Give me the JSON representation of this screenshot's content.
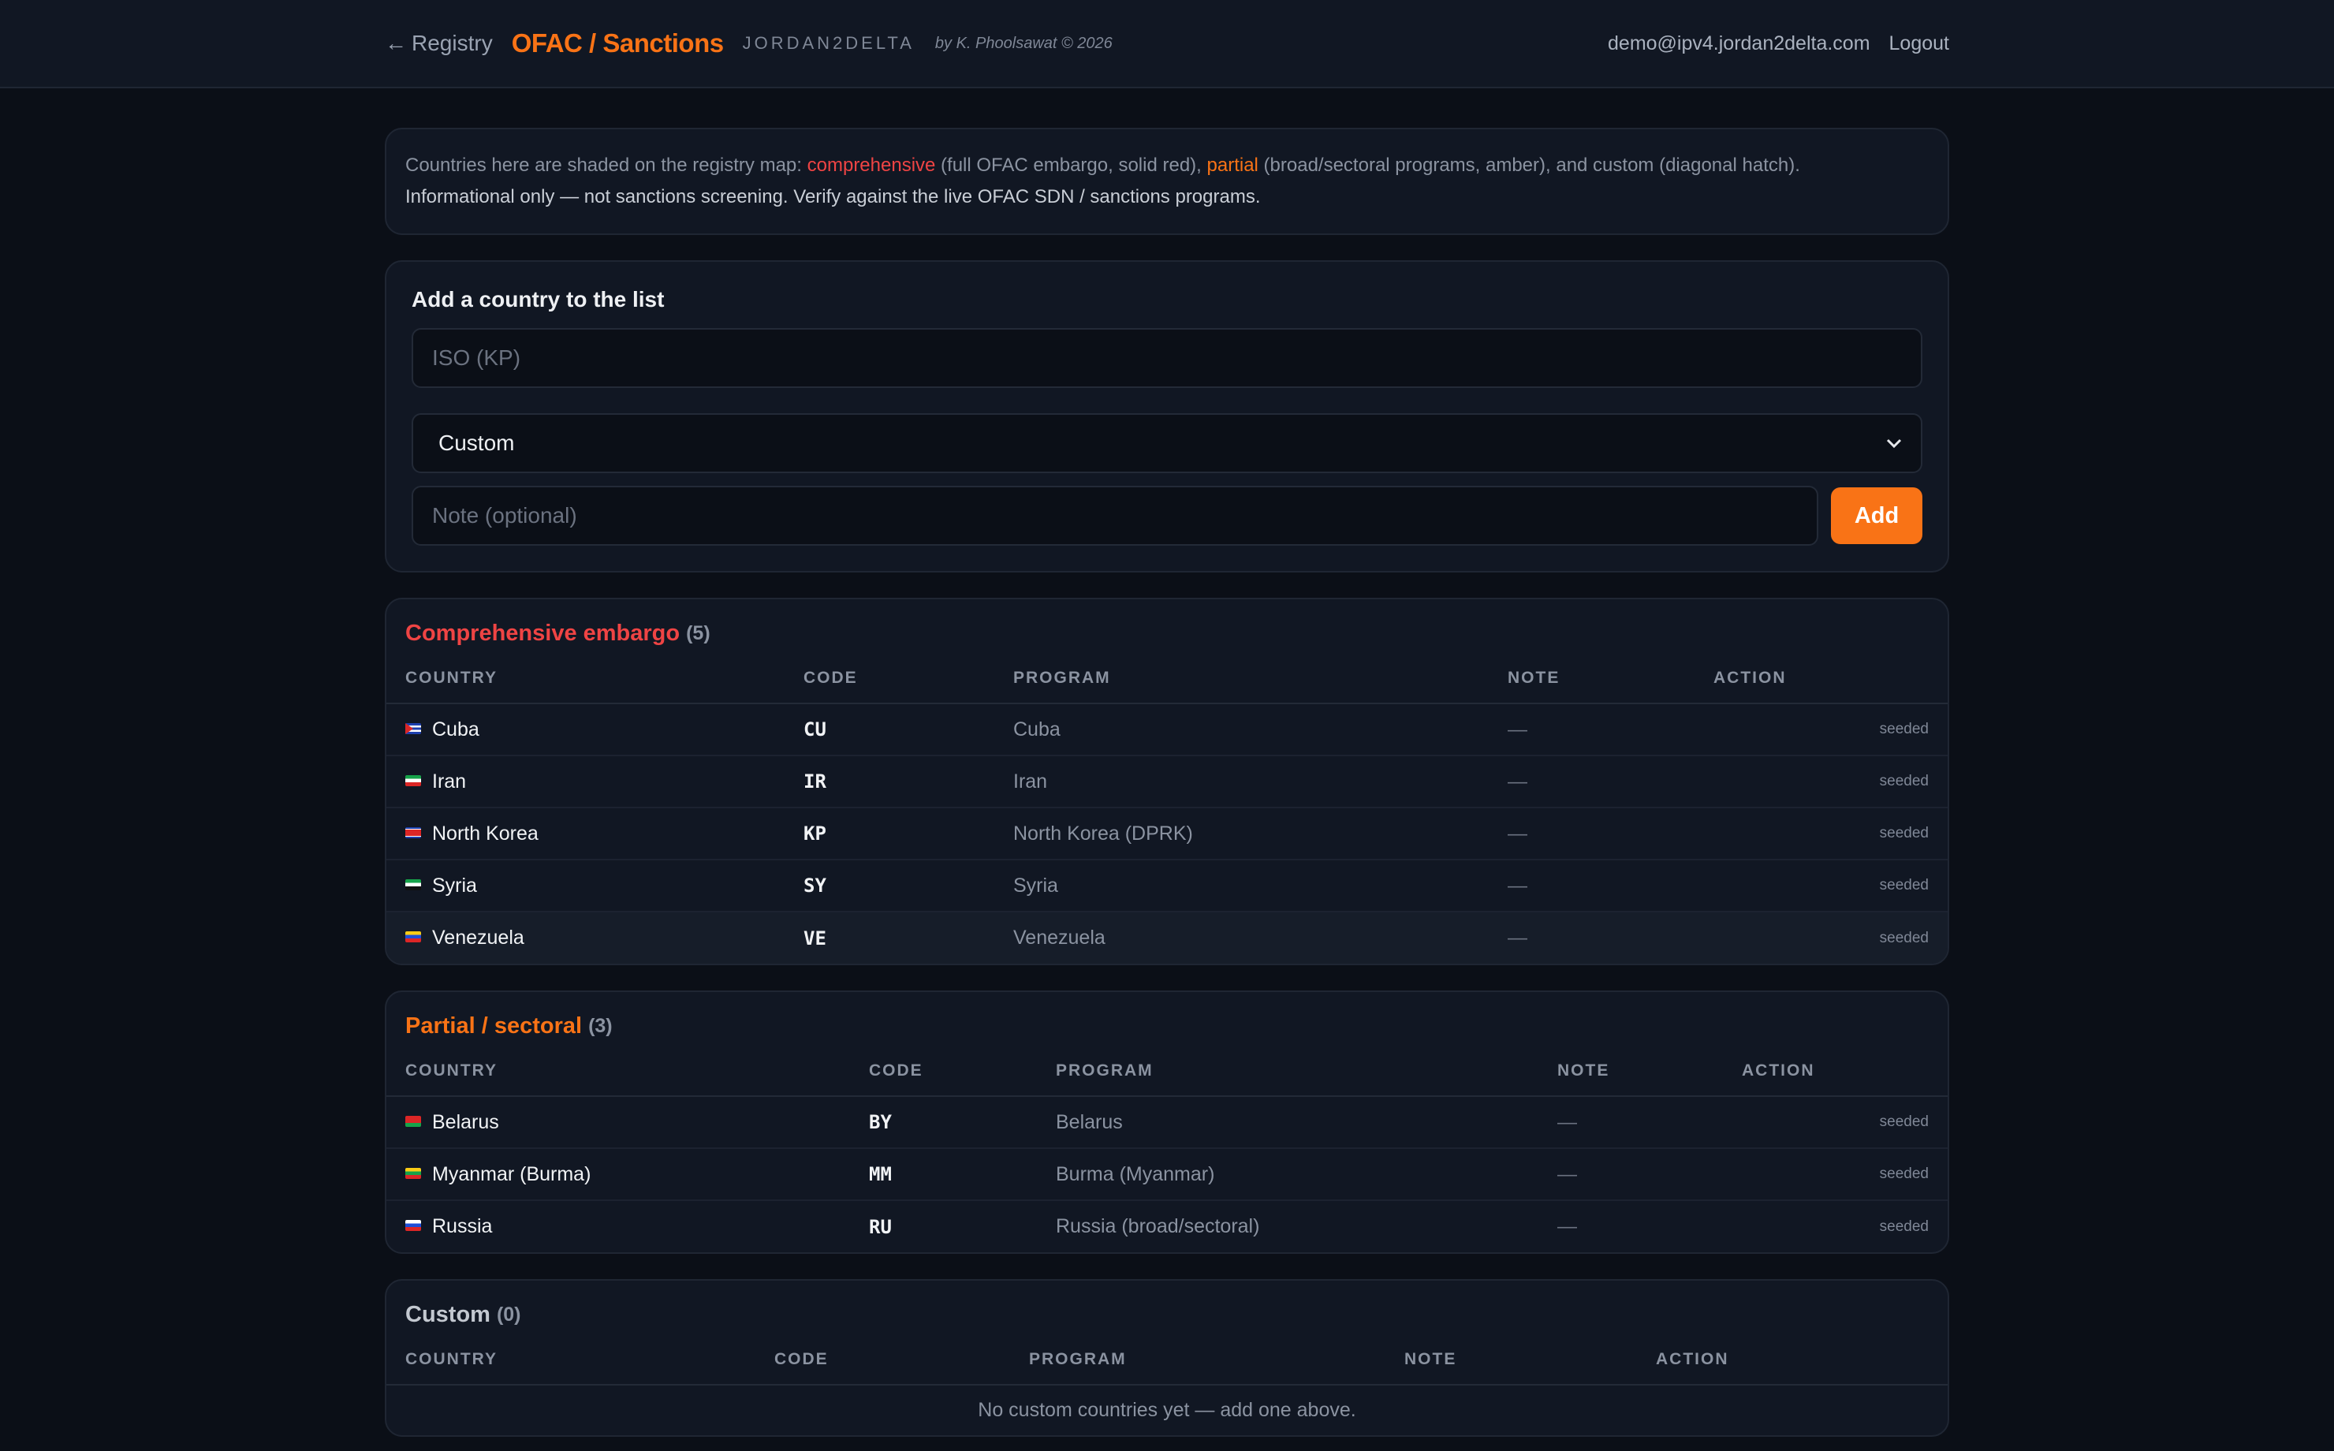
{
  "topbar": {
    "back_label": "Registry",
    "title": "OFAC / Sanctions",
    "brand": "JORDAN2DELTA",
    "byline": "by K. Phoolsawat © 2026",
    "user_email": "demo@ipv4.jordan2delta.com",
    "logout_label": "Logout"
  },
  "info": {
    "prefix": "Countries here are shaded on the registry map: ",
    "comprehensive": "comprehensive",
    "mid1": " (full OFAC embargo, solid red), ",
    "partial": "partial",
    "mid2": " (broad/sectoral programs, amber), and custom (diagonal hatch).",
    "line2": "Informational only — not sanctions screening. Verify against the live OFAC SDN / sanctions programs."
  },
  "add_form": {
    "title": "Add a country to the list",
    "iso_placeholder": "ISO (KP)",
    "category_selected": "Custom",
    "note_placeholder": "Note (optional)",
    "add_label": "Add"
  },
  "columns": {
    "country": "COUNTRY",
    "code": "CODE",
    "program": "PROGRAM",
    "note": "NOTE",
    "action": "ACTION"
  },
  "comprehensive": {
    "title": "Comprehensive embargo",
    "count": "(5)",
    "rows": [
      {
        "country": "Cuba",
        "code": "CU",
        "program": "Cuba",
        "note": "—",
        "action": "seeded"
      },
      {
        "country": "Iran",
        "code": "IR",
        "program": "Iran",
        "note": "—",
        "action": "seeded"
      },
      {
        "country": "North Korea",
        "code": "KP",
        "program": "North Korea (DPRK)",
        "note": "—",
        "action": "seeded"
      },
      {
        "country": "Syria",
        "code": "SY",
        "program": "Syria",
        "note": "—",
        "action": "seeded"
      },
      {
        "country": "Venezuela",
        "code": "VE",
        "program": "Venezuela",
        "note": "—",
        "action": "seeded"
      }
    ]
  },
  "partial": {
    "title": "Partial / sectoral",
    "count": "(3)",
    "rows": [
      {
        "country": "Belarus",
        "code": "BY",
        "program": "Belarus",
        "note": "—",
        "action": "seeded"
      },
      {
        "country": "Myanmar (Burma)",
        "code": "MM",
        "program": "Burma (Myanmar)",
        "note": "—",
        "action": "seeded"
      },
      {
        "country": "Russia",
        "code": "RU",
        "program": "Russia (broad/sectoral)",
        "note": "—",
        "action": "seeded"
      }
    ]
  },
  "custom": {
    "title": "Custom",
    "count": "(0)",
    "empty_text": "No custom countries yet — add one above."
  },
  "colors": {
    "accent": "#f97316",
    "embargo_red": "#ef4444",
    "background": "#0b0f17",
    "card": "#111723"
  }
}
